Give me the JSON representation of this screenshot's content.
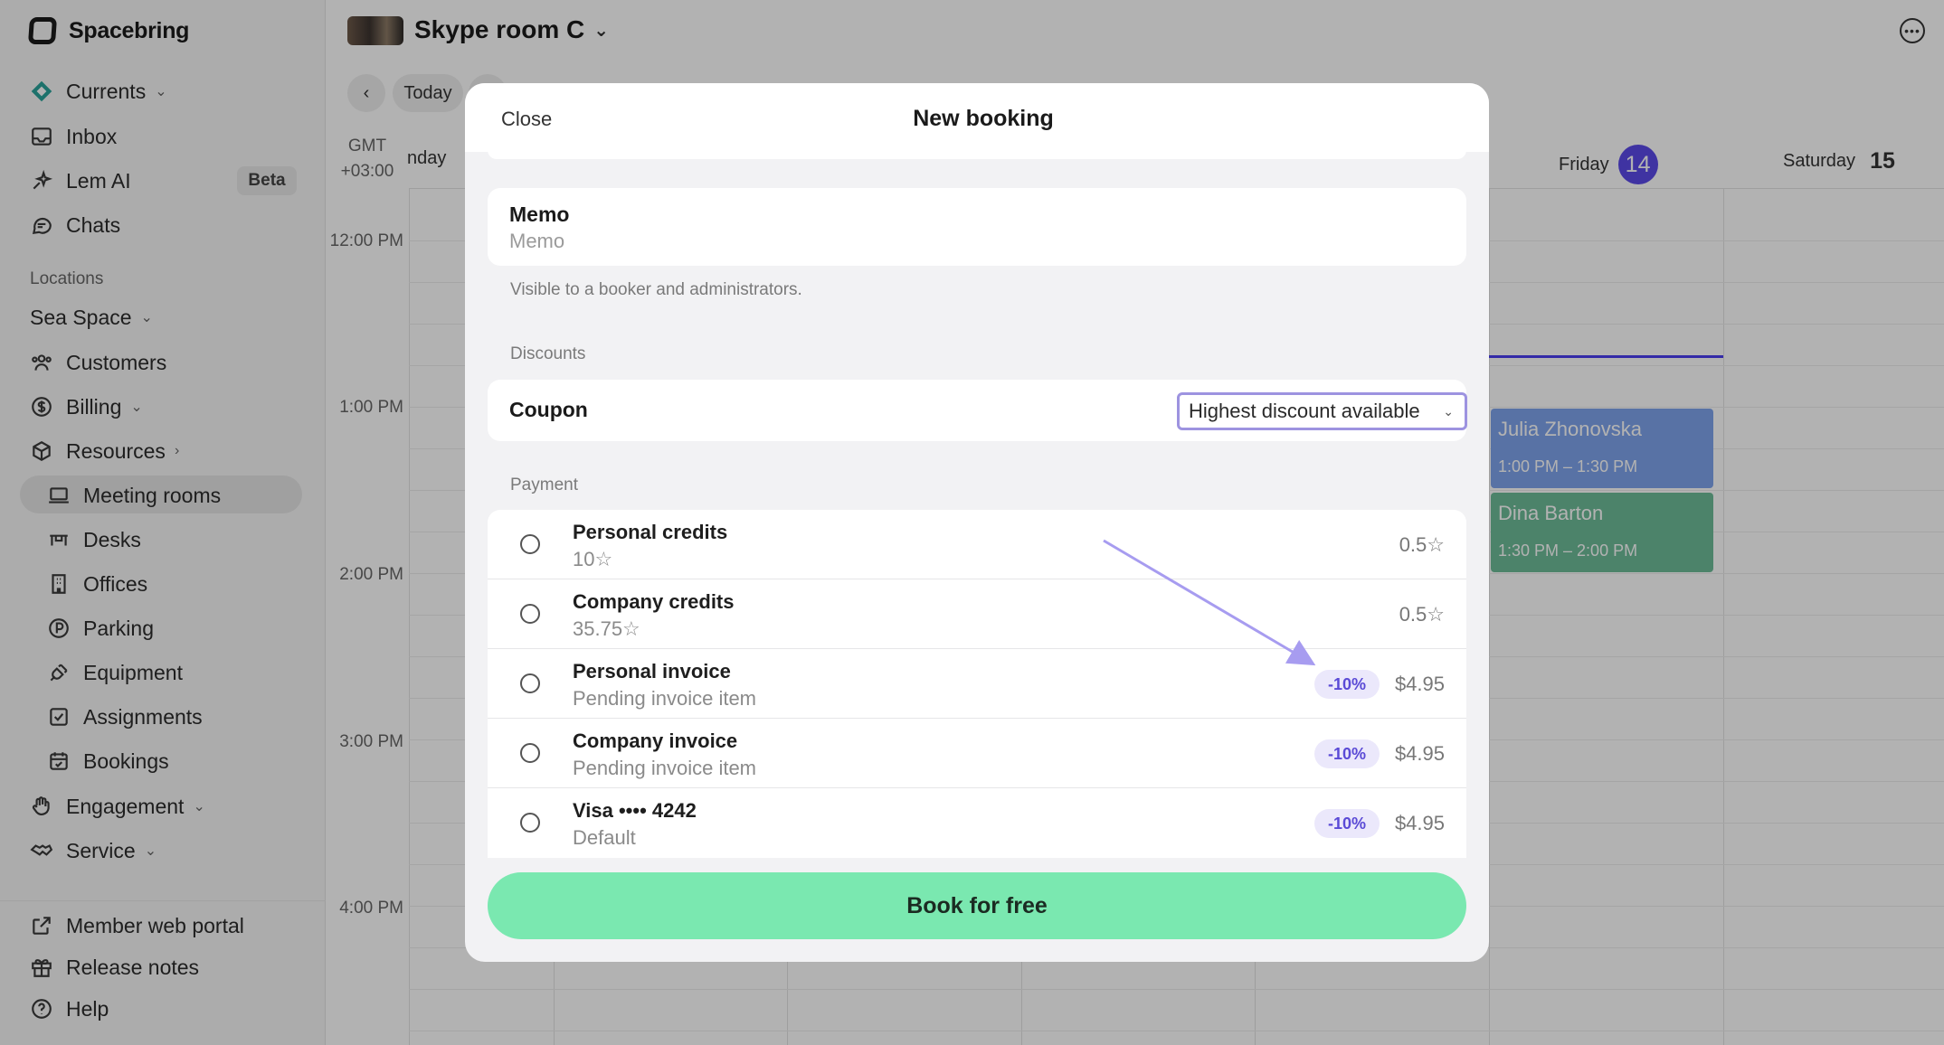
{
  "app": {
    "brand": "Spacebring"
  },
  "sidebar": {
    "top_items": [
      {
        "label": "Currents",
        "icon": "currents-icon",
        "chevron": true
      },
      {
        "label": "Inbox",
        "icon": "inbox-icon"
      },
      {
        "label": "Lem AI",
        "icon": "sparkle-icon",
        "badge": "Beta"
      },
      {
        "label": "Chats",
        "icon": "chat-icon"
      }
    ],
    "locations_label": "Locations",
    "location_name": "Sea Space",
    "location_items": [
      {
        "label": "Customers",
        "icon": "customers-icon"
      },
      {
        "label": "Billing",
        "icon": "dollar-icon"
      },
      {
        "label": "Resources",
        "icon": "cube-icon"
      }
    ],
    "resource_items": [
      {
        "label": "Meeting rooms",
        "icon": "meeting-room-icon",
        "active": true
      },
      {
        "label": "Desks",
        "icon": "desk-icon"
      },
      {
        "label": "Offices",
        "icon": "office-icon"
      },
      {
        "label": "Parking",
        "icon": "parking-icon"
      },
      {
        "label": "Equipment",
        "icon": "plug-icon"
      },
      {
        "label": "Assignments",
        "icon": "assignment-icon"
      },
      {
        "label": "Bookings",
        "icon": "calendar-icon"
      }
    ],
    "bottom_items": [
      {
        "label": "Engagement",
        "icon": "hand-icon"
      },
      {
        "label": "Service",
        "icon": "handshake-icon"
      }
    ],
    "footer_items": [
      {
        "label": "Member web portal",
        "icon": "external-link-icon"
      },
      {
        "label": "Release notes",
        "icon": "gift-icon"
      },
      {
        "label": "Help",
        "icon": "help-icon"
      }
    ]
  },
  "header": {
    "room_title": "Skype room C",
    "today_label": "Today"
  },
  "calendar": {
    "timezone": [
      "GMT",
      "+03:00"
    ],
    "days": [
      {
        "name": "Friday",
        "num": "14",
        "today": true
      },
      {
        "name": "Saturday",
        "num": "15",
        "today": false
      }
    ],
    "partial_day": "nday",
    "time_labels": [
      "12:00 PM",
      "1:00 PM",
      "2:00 PM",
      "3:00 PM",
      "4:00 PM"
    ],
    "events": [
      {
        "title": "Julia Zhonovska",
        "time": "1:00 PM – 1:30 PM",
        "color": "#7fa4ec"
      },
      {
        "title": "Dina Barton",
        "time": "1:30 PM – 2:00 PM",
        "color": "#6ebc98"
      }
    ]
  },
  "modal": {
    "close_label": "Close",
    "title": "New booking",
    "memo": {
      "label": "Memo",
      "placeholder": "Memo",
      "hint": "Visible to a booker and administrators."
    },
    "discounts_label": "Discounts",
    "coupon": {
      "label": "Coupon",
      "value": "Highest discount available"
    },
    "payment_label": "Payment",
    "payment_options": [
      {
        "title": "Personal credits",
        "subtitle": "10☆",
        "discount": "",
        "price": "0.5☆"
      },
      {
        "title": "Company credits",
        "subtitle": "35.75☆",
        "discount": "",
        "price": "0.5☆"
      },
      {
        "title": "Personal invoice",
        "subtitle": "Pending invoice item",
        "discount": "-10%",
        "price": "$4.95"
      },
      {
        "title": "Company invoice",
        "subtitle": "Pending invoice item",
        "discount": "-10%",
        "price": "$4.95"
      },
      {
        "title": "Visa •••• 4242",
        "subtitle": "Default",
        "discount": "-10%",
        "price": "$4.95"
      }
    ],
    "book_button": "Book for free"
  },
  "colors": {
    "accent": "#5b4ae8",
    "book_button": "#7ae8b0",
    "badge_bg": "#ebe8fb",
    "badge_text": "#5a4ad6"
  }
}
